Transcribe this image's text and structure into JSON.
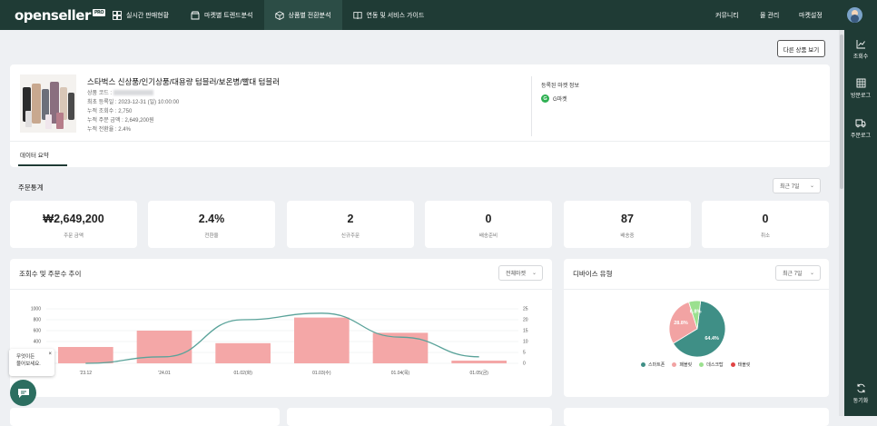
{
  "app": {
    "logo": "openseller",
    "logo_badge": "PRO"
  },
  "nav": [
    {
      "label": "실시간 판매현황",
      "icon": "dashboard-icon"
    },
    {
      "label": "마켓별 트렌드분석",
      "icon": "store-icon"
    },
    {
      "label": "상품별 전환분석",
      "icon": "box-icon"
    },
    {
      "label": "연동 및 서비스 가이드",
      "icon": "book-icon"
    }
  ],
  "top_right": {
    "community": "커뮤니티",
    "menu_manage": "몰 관리",
    "market_settings": "마켓설정"
  },
  "sidebar": [
    {
      "label": "조회수",
      "icon": "line-chart-icon"
    },
    {
      "label": "방문로그",
      "icon": "grid-icon"
    },
    {
      "label": "주문로그",
      "icon": "truck-icon"
    },
    {
      "label": "동기화",
      "icon": "sync-icon"
    }
  ],
  "other_product_button": "다른 상품 보기",
  "product": {
    "title": "스타벅스 신상품/인기상품/대용량 텀블러/보온병/빨대 텀블러",
    "code_label": "상품 코드 :",
    "first_registered": "최초 등록일 : 2023-12-31 (일) 10:00:00",
    "views": "누적 조회수 : 2,750",
    "order_amount": "누적 주문 금액 : 2,649,200원",
    "conversion": "누적 전환율 : 2.4%"
  },
  "market_info": {
    "label": "등록된 마켓 정보",
    "market_name": "G마켓",
    "market_icon_letter": "G"
  },
  "tabs": {
    "data_summary": "데이터 요약"
  },
  "order_stats": {
    "title": "주문통계",
    "period": "최근 7일",
    "cards": [
      {
        "value": "₩2,649,200",
        "label": "주문 금액"
      },
      {
        "value": "2.4%",
        "label": "전환율"
      },
      {
        "value": "2",
        "label": "신규주문"
      },
      {
        "value": "0",
        "label": "배송준비"
      },
      {
        "value": "87",
        "label": "배송중"
      },
      {
        "value": "0",
        "label": "취소"
      }
    ]
  },
  "trend": {
    "title": "조회수 및 주문수 추이",
    "filter": "전체마켓"
  },
  "device": {
    "title": "디바이스 유형",
    "period": "최근 7일"
  },
  "toast": {
    "line1": "무엇이든",
    "line2": "물어보세요."
  },
  "chart_data": [
    {
      "type": "bar",
      "categories": [
        "'23.12",
        "'24.01",
        "01.02(화)",
        "01.03(수)",
        "01.04(목)",
        "01.05(금)"
      ],
      "series": [
        {
          "type": "bar",
          "values": [
            300,
            600,
            370,
            840,
            560,
            50
          ],
          "color": "#f4a7a7",
          "axis": "left"
        },
        {
          "type": "line",
          "values": [
            0,
            3,
            20,
            23,
            12,
            3
          ],
          "color": "#5aa39a",
          "axis": "right"
        }
      ],
      "ylim_left": [
        0,
        1000
      ],
      "yticks_left": [
        0,
        200,
        400,
        600,
        800,
        1000
      ],
      "ylim_right": [
        0,
        25
      ],
      "yticks_right": [
        0,
        5,
        10,
        15,
        20,
        25
      ]
    },
    {
      "type": "pie",
      "labels": [
        "스마트폰",
        "패블릿",
        "데스크탑",
        "태블릿"
      ],
      "values": [
        64.4,
        28.8,
        6.8,
        0
      ],
      "data_labels": [
        "64.4%",
        "28.8%",
        "6.8%",
        ""
      ],
      "colors": [
        "#3f8f86",
        "#f2a3a3",
        "#9be08f",
        "#e04444"
      ]
    }
  ]
}
